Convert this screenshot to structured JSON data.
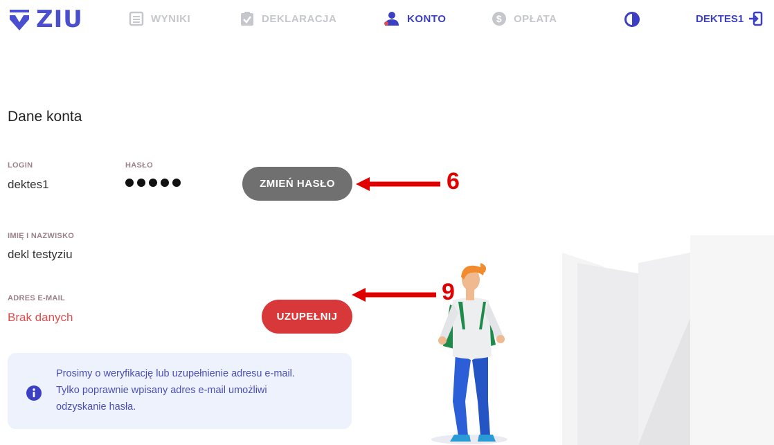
{
  "brand": {
    "name": "ZIU",
    "color": "#4a4fcf"
  },
  "nav": {
    "items": [
      {
        "label": "WYNIKI",
        "icon": "list-icon",
        "active": false
      },
      {
        "label": "DEKLARACJA",
        "icon": "clipboard-check-icon",
        "active": false
      },
      {
        "label": "KONTO",
        "icon": "user-icon",
        "active": true
      },
      {
        "label": "OPŁATA",
        "icon": "dollar-coin-icon",
        "active": false
      }
    ],
    "contrast_icon": "contrast-icon",
    "user": {
      "label": "DEKTES1",
      "icon": "logout-icon"
    }
  },
  "account": {
    "title": "Dane konta",
    "login": {
      "label": "LOGIN",
      "value": "dektes1"
    },
    "password": {
      "label": "HASŁO",
      "dots": 5
    },
    "change_password_button": "ZMIEŃ HASŁO",
    "name": {
      "label": "IMIĘ I NAZWISKO",
      "value": "dekl testyziu"
    },
    "email": {
      "label": "ADRES E-MAIL",
      "value": "Brak danych"
    },
    "fill_button": "UZUPEŁNIJ",
    "info": {
      "lines": [
        "Prosimy o weryfikację lub uzupełnienie adresu e-mail.",
        "Tylko poprawnie wpisany adres e-mail umożliwi",
        "odzyskanie hasła."
      ]
    }
  },
  "annotations": [
    {
      "number": "6",
      "color": "#e00000"
    },
    {
      "number": "9",
      "color": "#e00000"
    }
  ],
  "colors": {
    "accent": "#3b3fc4",
    "inactive": "#c5c7cc",
    "danger": "#d9383a",
    "neutral_button": "#707070",
    "info_bg": "#eef2fc"
  }
}
